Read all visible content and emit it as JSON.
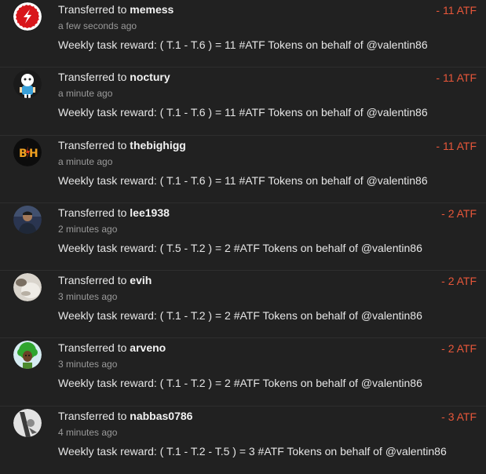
{
  "transfers": [
    {
      "prefix": "Transferred to",
      "user": "memess",
      "time": "a few seconds ago",
      "memo": "Weekly task reward: ( T.1 - T.6 ) = 11 #ATF Tokens on behalf of @valentin86",
      "amount": "- 11 ATF",
      "avatar": "red-circle-logo-icon"
    },
    {
      "prefix": "Transferred to",
      "user": "noctury",
      "time": "a minute ago",
      "memo": "Weekly task reward: ( T.1 - T.6 ) = 11 #ATF Tokens on behalf of @valentin86",
      "amount": "- 11 ATF",
      "avatar": "cartoon-character-icon"
    },
    {
      "prefix": "Transferred to",
      "user": "thebighigg",
      "time": "a minute ago",
      "memo": "Weekly task reward: ( T.1 - T.6 ) = 11 #ATF Tokens on behalf of @valentin86",
      "amount": "- 11 ATF",
      "avatar": "bh-logo-icon"
    },
    {
      "prefix": "Transferred to",
      "user": "lee1938",
      "time": "2 minutes ago",
      "memo": "Weekly task reward: ( T.5 - T.2 ) = 2 #ATF Tokens on behalf of @valentin86",
      "amount": "- 2 ATF",
      "avatar": "person-photo-icon"
    },
    {
      "prefix": "Transferred to",
      "user": "evih",
      "time": "3 minutes ago",
      "memo": "Weekly task reward: ( T.1 - T.2 ) = 2 #ATF Tokens on behalf of @valentin86",
      "amount": "- 2 ATF",
      "avatar": "light-photo-icon"
    },
    {
      "prefix": "Transferred to",
      "user": "arveno",
      "time": "3 minutes ago",
      "memo": "Weekly task reward: ( T.1 - T.2 ) = 2 #ATF Tokens on behalf of @valentin86",
      "amount": "- 2 ATF",
      "avatar": "green-afro-character-icon"
    },
    {
      "prefix": "Transferred to",
      "user": "nabbas0786",
      "time": "4 minutes ago",
      "memo": "Weekly task reward: ( T.1 - T.2 - T.5 ) = 3 #ATF Tokens on behalf of @valentin86",
      "amount": "- 3 ATF",
      "avatar": "grayscale-photo-icon"
    }
  ],
  "colors": {
    "background": "#212121",
    "amount": "#e8573a",
    "divider": "#2e2e2e",
    "secondary_text": "#9a9a9a"
  }
}
